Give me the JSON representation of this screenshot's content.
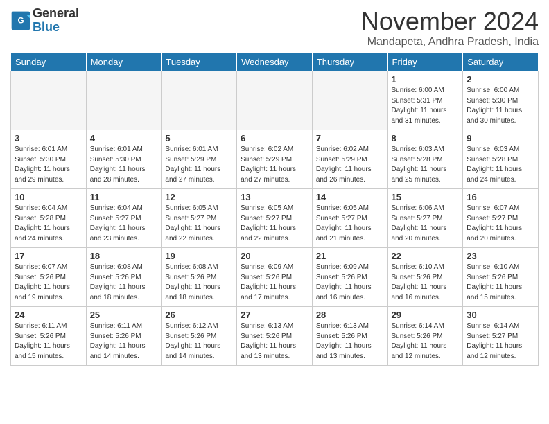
{
  "header": {
    "logo_general": "General",
    "logo_blue": "Blue",
    "month_title": "November 2024",
    "location": "Mandapeta, Andhra Pradesh, India"
  },
  "days_of_week": [
    "Sunday",
    "Monday",
    "Tuesday",
    "Wednesday",
    "Thursday",
    "Friday",
    "Saturday"
  ],
  "weeks": [
    [
      {
        "num": "",
        "info": "",
        "empty": true
      },
      {
        "num": "",
        "info": "",
        "empty": true
      },
      {
        "num": "",
        "info": "",
        "empty": true
      },
      {
        "num": "",
        "info": "",
        "empty": true
      },
      {
        "num": "",
        "info": "",
        "empty": true
      },
      {
        "num": "1",
        "info": "Sunrise: 6:00 AM\nSunset: 5:31 PM\nDaylight: 11 hours and 31 minutes.",
        "empty": false
      },
      {
        "num": "2",
        "info": "Sunrise: 6:00 AM\nSunset: 5:30 PM\nDaylight: 11 hours and 30 minutes.",
        "empty": false
      }
    ],
    [
      {
        "num": "3",
        "info": "Sunrise: 6:01 AM\nSunset: 5:30 PM\nDaylight: 11 hours and 29 minutes.",
        "empty": false
      },
      {
        "num": "4",
        "info": "Sunrise: 6:01 AM\nSunset: 5:30 PM\nDaylight: 11 hours and 28 minutes.",
        "empty": false
      },
      {
        "num": "5",
        "info": "Sunrise: 6:01 AM\nSunset: 5:29 PM\nDaylight: 11 hours and 27 minutes.",
        "empty": false
      },
      {
        "num": "6",
        "info": "Sunrise: 6:02 AM\nSunset: 5:29 PM\nDaylight: 11 hours and 27 minutes.",
        "empty": false
      },
      {
        "num": "7",
        "info": "Sunrise: 6:02 AM\nSunset: 5:29 PM\nDaylight: 11 hours and 26 minutes.",
        "empty": false
      },
      {
        "num": "8",
        "info": "Sunrise: 6:03 AM\nSunset: 5:28 PM\nDaylight: 11 hours and 25 minutes.",
        "empty": false
      },
      {
        "num": "9",
        "info": "Sunrise: 6:03 AM\nSunset: 5:28 PM\nDaylight: 11 hours and 24 minutes.",
        "empty": false
      }
    ],
    [
      {
        "num": "10",
        "info": "Sunrise: 6:04 AM\nSunset: 5:28 PM\nDaylight: 11 hours and 24 minutes.",
        "empty": false
      },
      {
        "num": "11",
        "info": "Sunrise: 6:04 AM\nSunset: 5:27 PM\nDaylight: 11 hours and 23 minutes.",
        "empty": false
      },
      {
        "num": "12",
        "info": "Sunrise: 6:05 AM\nSunset: 5:27 PM\nDaylight: 11 hours and 22 minutes.",
        "empty": false
      },
      {
        "num": "13",
        "info": "Sunrise: 6:05 AM\nSunset: 5:27 PM\nDaylight: 11 hours and 22 minutes.",
        "empty": false
      },
      {
        "num": "14",
        "info": "Sunrise: 6:05 AM\nSunset: 5:27 PM\nDaylight: 11 hours and 21 minutes.",
        "empty": false
      },
      {
        "num": "15",
        "info": "Sunrise: 6:06 AM\nSunset: 5:27 PM\nDaylight: 11 hours and 20 minutes.",
        "empty": false
      },
      {
        "num": "16",
        "info": "Sunrise: 6:07 AM\nSunset: 5:27 PM\nDaylight: 11 hours and 20 minutes.",
        "empty": false
      }
    ],
    [
      {
        "num": "17",
        "info": "Sunrise: 6:07 AM\nSunset: 5:26 PM\nDaylight: 11 hours and 19 minutes.",
        "empty": false
      },
      {
        "num": "18",
        "info": "Sunrise: 6:08 AM\nSunset: 5:26 PM\nDaylight: 11 hours and 18 minutes.",
        "empty": false
      },
      {
        "num": "19",
        "info": "Sunrise: 6:08 AM\nSunset: 5:26 PM\nDaylight: 11 hours and 18 minutes.",
        "empty": false
      },
      {
        "num": "20",
        "info": "Sunrise: 6:09 AM\nSunset: 5:26 PM\nDaylight: 11 hours and 17 minutes.",
        "empty": false
      },
      {
        "num": "21",
        "info": "Sunrise: 6:09 AM\nSunset: 5:26 PM\nDaylight: 11 hours and 16 minutes.",
        "empty": false
      },
      {
        "num": "22",
        "info": "Sunrise: 6:10 AM\nSunset: 5:26 PM\nDaylight: 11 hours and 16 minutes.",
        "empty": false
      },
      {
        "num": "23",
        "info": "Sunrise: 6:10 AM\nSunset: 5:26 PM\nDaylight: 11 hours and 15 minutes.",
        "empty": false
      }
    ],
    [
      {
        "num": "24",
        "info": "Sunrise: 6:11 AM\nSunset: 5:26 PM\nDaylight: 11 hours and 15 minutes.",
        "empty": false
      },
      {
        "num": "25",
        "info": "Sunrise: 6:11 AM\nSunset: 5:26 PM\nDaylight: 11 hours and 14 minutes.",
        "empty": false
      },
      {
        "num": "26",
        "info": "Sunrise: 6:12 AM\nSunset: 5:26 PM\nDaylight: 11 hours and 14 minutes.",
        "empty": false
      },
      {
        "num": "27",
        "info": "Sunrise: 6:13 AM\nSunset: 5:26 PM\nDaylight: 11 hours and 13 minutes.",
        "empty": false
      },
      {
        "num": "28",
        "info": "Sunrise: 6:13 AM\nSunset: 5:26 PM\nDaylight: 11 hours and 13 minutes.",
        "empty": false
      },
      {
        "num": "29",
        "info": "Sunrise: 6:14 AM\nSunset: 5:26 PM\nDaylight: 11 hours and 12 minutes.",
        "empty": false
      },
      {
        "num": "30",
        "info": "Sunrise: 6:14 AM\nSunset: 5:27 PM\nDaylight: 11 hours and 12 minutes.",
        "empty": false
      }
    ]
  ]
}
